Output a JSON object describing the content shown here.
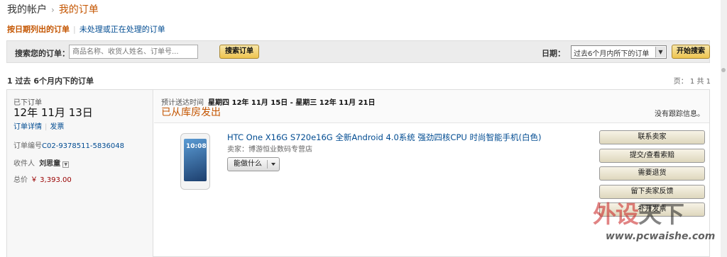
{
  "breadcrumb": {
    "root": "我的帐户",
    "current": "我的订单"
  },
  "subnav": {
    "active": "按日期列出的订单",
    "other": "未处理或正在处理的订单"
  },
  "search": {
    "label": "搜索您的订单：",
    "placeholder": "商品名称、收货人姓名、订单号...",
    "button": "搜索订单",
    "date_label": "日期：",
    "date_value": "过去6个月内所下的订单",
    "go_button": "开始搜索"
  },
  "results": {
    "summary": "1 过去 6个月内下的订单",
    "pager": "页： 1 共 1"
  },
  "order": {
    "placed_label": "已下订单",
    "placed_date": "12年 11月 13日",
    "detail_link": "订单详情",
    "invoice_link": "发票",
    "order_number_label": "订单编号",
    "order_number": "C02-9378511-5836048",
    "recipient_label": "收件人",
    "recipient": "刘思童",
    "total_label": "总价",
    "total": "￥ 3,393.00",
    "delivery_label": "预计送达时间",
    "delivery_range": "星期四 12年 11月 15日 - 星期三 12年 11月 21日",
    "status": "已从库房发出",
    "tracking": "没有跟踪信息。",
    "product": {
      "image_text": "10:08",
      "title": "HTC One X16G S720e16G 全新Android 4.0系统 强劲四核CPU 时尚智能手机(白色)",
      "seller": "卖家：博游恒业数码专营店",
      "action": "能做什么"
    },
    "side_buttons": [
      "联系卖家",
      "提交/查看索赔",
      "需要退货",
      "留下卖家反馈",
      "补开发票"
    ]
  },
  "watermark": {
    "brand_a": "外设",
    "brand_b": "天下",
    "url": "www.pcwaishe.com"
  }
}
